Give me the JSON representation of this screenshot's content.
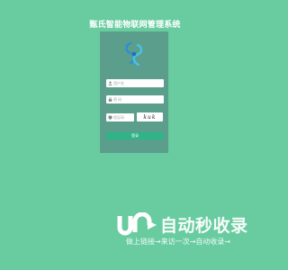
{
  "app": {
    "title": "甄氏智能物联网管理系统"
  },
  "login": {
    "username_placeholder": "用户名",
    "password_placeholder": "密 码",
    "captcha_placeholder": "验证码",
    "captcha_text": "kuk",
    "submit_label": "登录",
    "accent_color": "#2fb488"
  },
  "watermark": {
    "brand": "自动秒收录",
    "tagline": "做上链接→来访一次→自动收录→"
  }
}
